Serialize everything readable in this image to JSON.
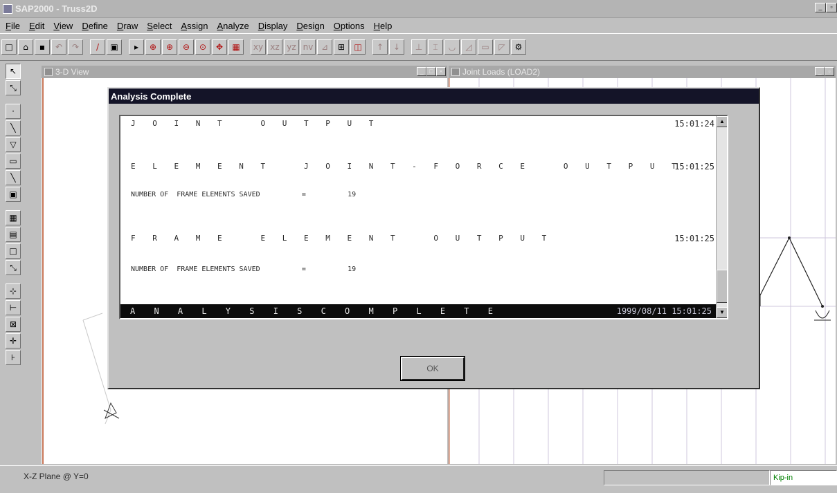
{
  "app": {
    "title": "SAP2000 - Truss2D"
  },
  "menu": [
    "File",
    "Edit",
    "View",
    "Define",
    "Draw",
    "Select",
    "Assign",
    "Analyze",
    "Display",
    "Design",
    "Options",
    "Help"
  ],
  "windows": {
    "left_title": "3-D View",
    "right_title": "Joint Loads (LOAD2)"
  },
  "dialog": {
    "title": "Analysis Complete",
    "lines": [
      {
        "text": "J O I N T   O U T P U T",
        "time": "15:01:24"
      },
      {
        "text": "E L E M E N T   J O I N T - F O R C E   O U T P U T",
        "time": "15:01:25"
      },
      {
        "text": "NUMBER OF  FRAME ELEMENTS SAVED          =          19",
        "time": ""
      },
      {
        "text": "F R A M E   E L E M E N T   O U T P U T",
        "time": "15:01:25"
      },
      {
        "text": "NUMBER OF  FRAME ELEMENTS SAVED          =          19",
        "time": ""
      }
    ],
    "complete_label": "A N A L Y S I S   C O M P L E T E",
    "complete_date": "1999/08/11  15:01:25",
    "ok_label": "OK"
  },
  "status": {
    "plane": "X-Z Plane @ Y=0",
    "units": "Kip-in"
  },
  "icons": {
    "app": "sap2000-app-icon",
    "pointer": "pointer-icon",
    "node": "joint-icon",
    "frame": "frame-icon"
  }
}
